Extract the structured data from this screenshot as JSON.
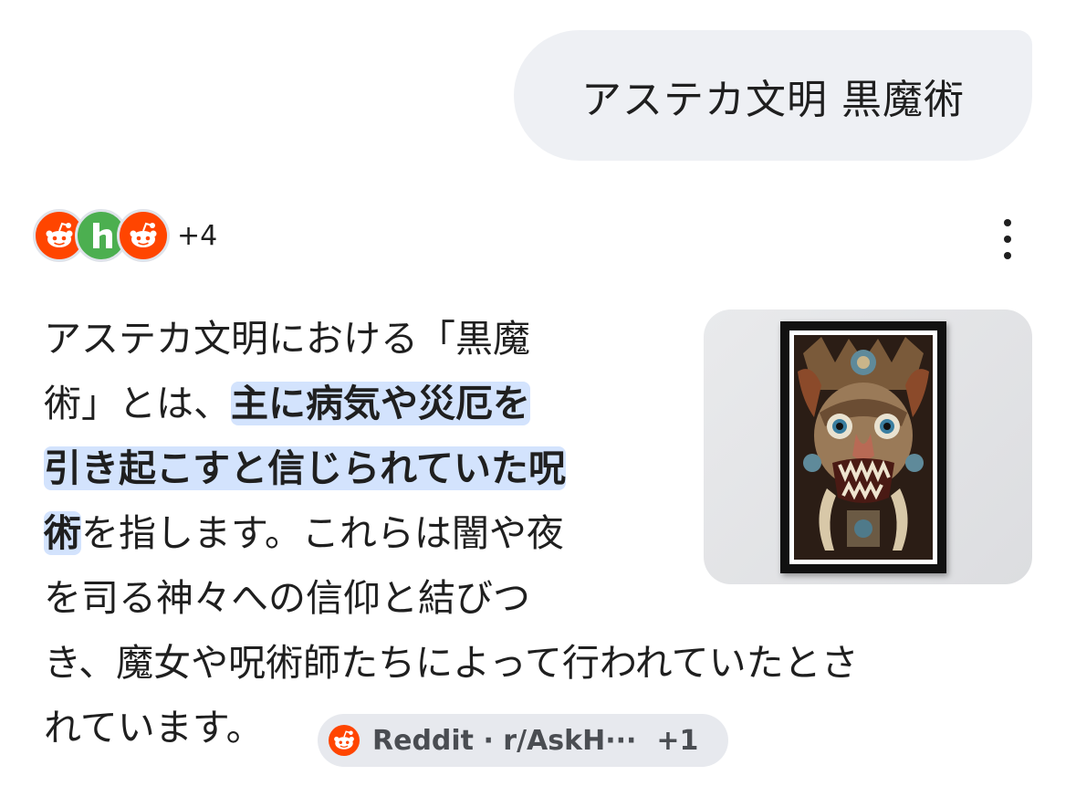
{
  "query": {
    "text": "アステカ文明 黒魔術"
  },
  "sources": {
    "icons": [
      "reddit-icon",
      "h-site-icon",
      "reddit-icon"
    ],
    "more_label": "+4",
    "menu_icon": "more-vert-icon"
  },
  "answer": {
    "line1": "アステカ文明における「黒魔",
    "line2_plain": "術」とは、",
    "line2_bold": "主に病気や災厄を",
    "line3_bold": "引き起こすと信じられていた呪",
    "line4_bold": "術",
    "line4_plain": "を指します。これらは闇や夜",
    "line5": "を司る神々への信仰と結びつ",
    "line6": "き、魔女や呪術師たちによって行われていたとさ",
    "line7": "れています。"
  },
  "thumbnail": {
    "icon": "framed-aztec-mask-art"
  },
  "citation_chip": {
    "label": "Reddit · r/AskH···",
    "count": "+1",
    "icon": "reddit-icon"
  },
  "colors": {
    "bubble_bg": "#eef0f4",
    "highlight": "#d3e3fd",
    "reddit": "#ff4500",
    "h_site": "#4caf50",
    "chip_bg": "#e7e9ee"
  }
}
